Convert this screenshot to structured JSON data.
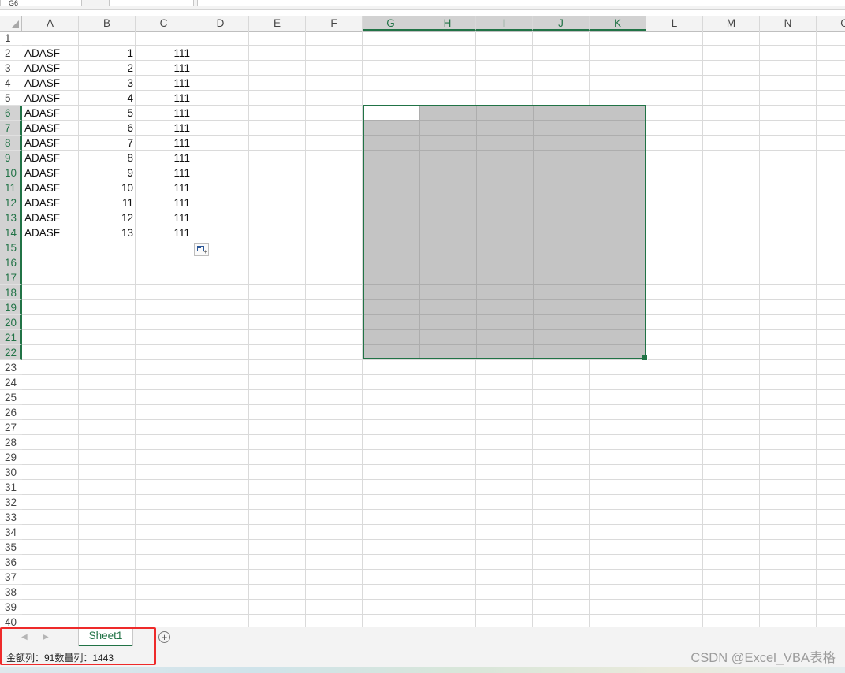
{
  "formula_bar": {
    "name_box": "G6"
  },
  "columns": [
    "A",
    "B",
    "C",
    "D",
    "E",
    "F",
    "G",
    "H",
    "I",
    "J",
    "K",
    "L",
    "M",
    "N",
    "O"
  ],
  "selected_columns": [
    "G",
    "H",
    "I",
    "J",
    "K"
  ],
  "rows": [
    "1",
    "2",
    "3",
    "4",
    "5",
    "6",
    "7",
    "8",
    "9",
    "10",
    "11",
    "12",
    "13",
    "14",
    "15",
    "16",
    "17",
    "18",
    "19",
    "20",
    "21",
    "22",
    "23",
    "24",
    "25",
    "26",
    "27",
    "28",
    "29",
    "30",
    "31",
    "32",
    "33",
    "34",
    "35",
    "36",
    "37",
    "38",
    "39",
    "40"
  ],
  "selected_rows": [
    "6",
    "7",
    "8",
    "9",
    "10",
    "11",
    "12",
    "13",
    "14",
    "15",
    "16",
    "17",
    "18",
    "19",
    "20",
    "21",
    "22"
  ],
  "table": [
    [
      "ADASF",
      "1",
      "111"
    ],
    [
      "ADASF",
      "2",
      "111"
    ],
    [
      "ADASF",
      "3",
      "111"
    ],
    [
      "ADASF",
      "4",
      "111"
    ],
    [
      "ADASF",
      "5",
      "111"
    ],
    [
      "ADASF",
      "6",
      "111"
    ],
    [
      "ADASF",
      "7",
      "111"
    ],
    [
      "ADASF",
      "8",
      "111"
    ],
    [
      "ADASF",
      "9",
      "111"
    ],
    [
      "ADASF",
      "10",
      "111"
    ],
    [
      "ADASF",
      "11",
      "111"
    ],
    [
      "ADASF",
      "12",
      "111"
    ],
    [
      "ADASF",
      "13",
      "111"
    ]
  ],
  "selection": {
    "range": "G6:K22",
    "active_cell": "G6"
  },
  "sheet_tabs": {
    "active": "Sheet1"
  },
  "status_bar": {
    "text": "金额列：91数量列：1443"
  },
  "watermark": "CSDN @Excel_VBA表格",
  "colors": {
    "accent": "#217346",
    "selection_fill": "#c4c4c4",
    "highlight_border": "#ee2a2a"
  }
}
